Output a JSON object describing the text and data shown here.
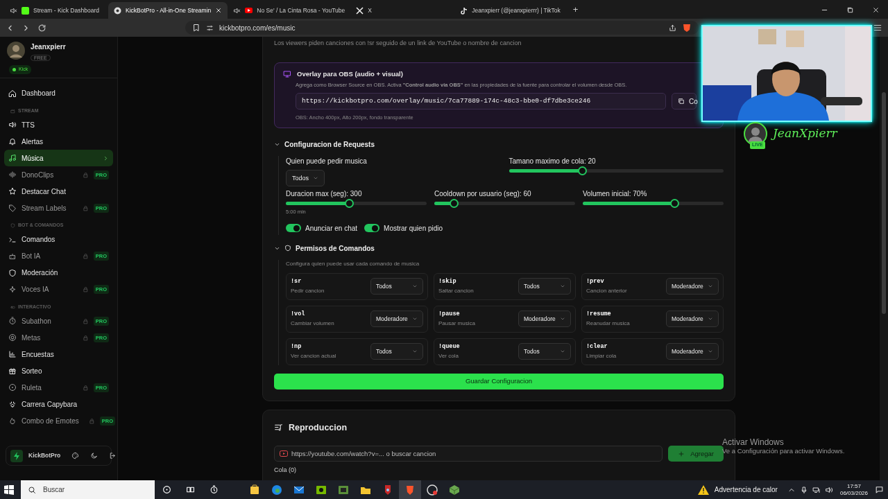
{
  "browser": {
    "tabs": [
      {
        "label": "Stream - Kick Dashboard",
        "selected": false,
        "muted": true
      },
      {
        "label": "KickBotPro - All-in-One Streamin",
        "selected": true,
        "muted": false
      },
      {
        "label": "No Se' / La Cinta Rosa - YouTube",
        "selected": false,
        "muted": true
      },
      {
        "label": "X",
        "selected": false,
        "muted": false
      },
      {
        "label": "Jeanxpierr (@jeanxpierrr) | TikTok",
        "selected": false,
        "muted": false
      }
    ],
    "new_tab": "+",
    "url": "kickbotpro.com/es/music"
  },
  "sidebar": {
    "user": {
      "name": "Jeanxpierr",
      "plan": "FREE",
      "platform": "Kick"
    },
    "nav": [
      {
        "kind": "item",
        "label": "Dashboard",
        "selected": false,
        "locked": false
      },
      {
        "kind": "section",
        "label": "STREAM"
      },
      {
        "kind": "item",
        "label": "TTS",
        "selected": false,
        "locked": false
      },
      {
        "kind": "item",
        "label": "Alertas",
        "selected": false,
        "locked": false
      },
      {
        "kind": "item",
        "label": "Música",
        "selected": true,
        "locked": false
      },
      {
        "kind": "item",
        "label": "DonoClips",
        "selected": false,
        "locked": true,
        "badge": "PRO"
      },
      {
        "kind": "item",
        "label": "Destacar Chat",
        "selected": false,
        "locked": false
      },
      {
        "kind": "item",
        "label": "Stream Labels",
        "selected": false,
        "locked": true,
        "badge": "PRO"
      },
      {
        "kind": "section",
        "label": "BOT & COMANDOS"
      },
      {
        "kind": "item",
        "label": "Comandos",
        "selected": false,
        "locked": false
      },
      {
        "kind": "item",
        "label": "Bot IA",
        "selected": false,
        "locked": true,
        "badge": "PRO"
      },
      {
        "kind": "item",
        "label": "Moderación",
        "selected": false,
        "locked": false
      },
      {
        "kind": "item",
        "label": "Voces IA",
        "selected": false,
        "locked": true,
        "badge": "PRO"
      },
      {
        "kind": "section",
        "label": "INTERACTIVO"
      },
      {
        "kind": "item",
        "label": "Subathon",
        "selected": false,
        "locked": true,
        "badge": "PRO"
      },
      {
        "kind": "item",
        "label": "Metas",
        "selected": false,
        "locked": true,
        "badge": "PRO"
      },
      {
        "kind": "item",
        "label": "Encuestas",
        "selected": false,
        "locked": false
      },
      {
        "kind": "item",
        "label": "Sorteo",
        "selected": false,
        "locked": false
      },
      {
        "kind": "item",
        "label": "Ruleta",
        "selected": false,
        "locked": true,
        "badge": "PRO"
      },
      {
        "kind": "item",
        "label": "Carrera Capybara",
        "selected": false,
        "locked": false
      },
      {
        "kind": "item",
        "label": "Combo de Emotes",
        "selected": false,
        "locked": true,
        "badge": "PRO"
      }
    ],
    "footer": {
      "brand": "KickBotPro"
    }
  },
  "main": {
    "intro": "Los viewers piden canciones con !sr seguido de un link de YouTube o nombre de cancion",
    "overlay": {
      "title": "Overlay para OBS (audio + visual)",
      "description": "Agrega como Browser Source en OBS. Activa **\"Control audio via OBS\"** en las propiedades de la fuente para controlar el volumen desde OBS.",
      "url": "https://kickbotpro.com/overlay/music/7ca77889-174c-48c3-bbe0-df7dbe3ce246",
      "copy_label": "Co",
      "note": "OBS: Ancho 400px, Alto 200px, fondo transparente"
    },
    "requests": {
      "title": "Configuracion de Requests",
      "expanded": true,
      "who_label": "Quien puede pedir musica",
      "who_value": "Todos",
      "sliders": [
        {
          "label": "Tamano maximo de cola: 20",
          "level": 0.34
        },
        {
          "label": "Duracion max (seg): 300",
          "level": 0.45,
          "hint": "5:00 min"
        },
        {
          "label": "Cooldown por usuario (seg): 60",
          "level": 0.14
        },
        {
          "label": "Volumen inicial: 70%",
          "level": 0.65
        }
      ],
      "toggles": [
        {
          "label": "Anunciar en chat",
          "on": true
        },
        {
          "label": "Mostrar quien pidio",
          "on": true
        }
      ]
    },
    "permissions": {
      "title": "Permisos de Comandos",
      "expanded": true,
      "description": "Configura quien puede usar cada comando de musica",
      "commands": [
        {
          "command": "!sr",
          "description": "Pedir cancion",
          "role": "Todos"
        },
        {
          "command": "!skip",
          "description": "Saltar cancion",
          "role": "Todos"
        },
        {
          "command": "!prev",
          "description": "Cancion anterior",
          "role": "Moderadore"
        },
        {
          "command": "!vol",
          "description": "Cambiar volumen",
          "role": "Moderadore"
        },
        {
          "command": "!pause",
          "description": "Pausar musica",
          "role": "Moderadore"
        },
        {
          "command": "!resume",
          "description": "Reanudar musica",
          "role": "Moderadore"
        },
        {
          "command": "!np",
          "description": "Ver cancion actual",
          "role": "Todos"
        },
        {
          "command": "!queue",
          "description": "Ver cola",
          "role": "Todos"
        },
        {
          "command": "!clear",
          "description": "Limpiar cola",
          "role": "Moderadore"
        }
      ]
    },
    "save_label": "Guardar Configuracion"
  },
  "playback": {
    "title": "Reproduccion",
    "placeholder": "https://youtube.com/watch?v=... o buscar cancion",
    "add_label": "Agregar",
    "queue_label": "Cola (0)"
  },
  "webcam": {
    "kind": "picture",
    "streamer": "JeanXpierr",
    "badge": "LIVE"
  },
  "windows_notice": {
    "title": "Activar Windows",
    "text": "Ve a Configuración para activar Windows."
  },
  "taskbar": {
    "search_placeholder": "Buscar",
    "apps": [
      {
        "selected": false
      },
      {
        "selected": false
      },
      {
        "selected": false
      },
      {
        "selected": false
      },
      {
        "selected": false
      },
      {
        "selected": false
      },
      {
        "selected": false
      },
      {
        "selected": true
      },
      {
        "selected": false
      },
      {
        "selected": false
      }
    ],
    "notice": "Advertencia de calor",
    "time": "17:57",
    "date": "06/03/2026"
  }
}
